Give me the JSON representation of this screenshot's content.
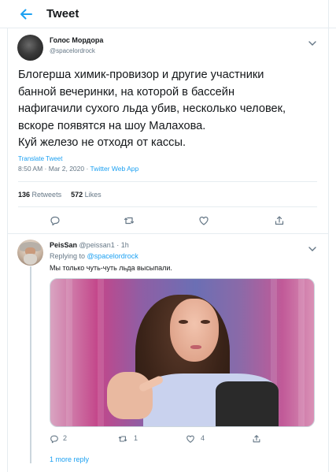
{
  "header": {
    "title": "Tweet"
  },
  "tweet": {
    "author_name": "Голос Мордора",
    "author_handle": "@spacelordrock",
    "text_lines": [
      "Блогерша химик-провизор и другие участники",
      "банной вечеринки, на которой в бассейн",
      "нафигачили сухого льда убив, несколько человек,",
      "вскоре появятся на шоу Малахова.",
      "Куй железо не отходя от кассы."
    ],
    "translate_label": "Translate Tweet",
    "timestamp": "8:50 AM · Mar 2, 2020",
    "separator": " · ",
    "source": "Twitter Web App",
    "retweets_count": "136",
    "retweets_label": "Retweets",
    "likes_count": "572",
    "likes_label": "Likes"
  },
  "reply": {
    "author_name": "PeisSan",
    "author_handle": "@peissan1",
    "time": "· 1h",
    "replying_prefix": "Replying to",
    "replying_to": "@spacelordrock",
    "text": "Мы только чуть-чуть льда высыпали.",
    "replies_count": "2",
    "retweets_count": "1",
    "likes_count": "4"
  },
  "more_replies_label": "1 more reply",
  "colors": {
    "accent": "#1da1f2",
    "secondary_text": "#657786",
    "border": "#e6ecf0"
  },
  "icons": {
    "back": "arrow-left-icon",
    "caret": "chevron-down-icon",
    "reply": "speech-bubble-icon",
    "retweet": "retweet-icon",
    "like": "heart-icon",
    "share": "share-icon"
  }
}
